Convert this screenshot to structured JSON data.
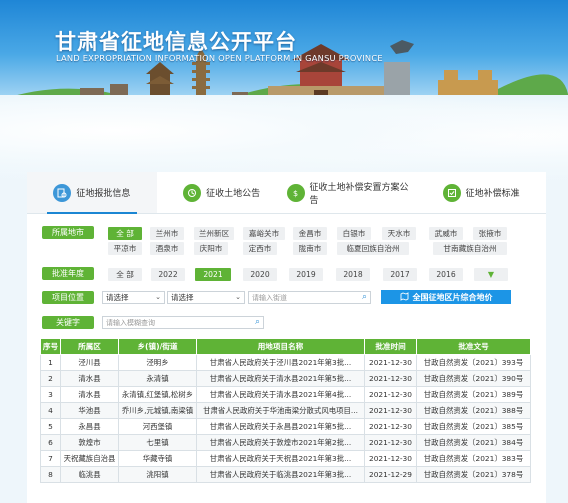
{
  "banner": {
    "title": "甘肃省征地信息公开平台",
    "subtitle": "LAND EXPROPRIATION INFORMATION OPEN PLATFORM IN GANSU PROVINCE"
  },
  "tabs": [
    {
      "label": "征地报批信息",
      "icon": "document-search-icon",
      "active": true
    },
    {
      "label": "征收土地公告",
      "icon": "announcement-icon",
      "active": false
    },
    {
      "label": "征收土地补偿安置方案公告",
      "icon": "compensation-icon",
      "active": false
    },
    {
      "label": "征地补偿标准",
      "icon": "standard-icon",
      "active": false
    }
  ],
  "filters": {
    "region_label": "所属地市",
    "regions": [
      "全 部",
      "兰州市",
      "兰州新区",
      "嘉峪关市",
      "金昌市",
      "白银市",
      "天水市",
      "武威市",
      "张掖市",
      "平凉市",
      "酒泉市",
      "庆阳市",
      "定西市",
      "陇南市",
      "临夏回族自治州",
      "甘南藏族自治州"
    ],
    "active_region": "全 部",
    "year_label": "批准年度",
    "years": [
      "全 部",
      "2022",
      "2021",
      "2020",
      "2019",
      "2018",
      "2017",
      "2016"
    ],
    "active_year": "2021",
    "location_label": "项目位置",
    "select1": "请选择",
    "select2": "请选择",
    "street_placeholder": "请输入街道",
    "map_button": "全国征地区片综合地价",
    "keyword_label": "关键字",
    "keyword_placeholder": "请输入模糊查询"
  },
  "table": {
    "headers": [
      "序号",
      "所属区",
      "乡(镇)/街道",
      "用地项目名称",
      "批准时间",
      "批准文号"
    ],
    "rows": [
      [
        "1",
        "泾川县",
        "泾明乡",
        "甘肃省人民政府关于泾川县2021年第3批...",
        "2021-12-30",
        "甘政自然资发〔2021〕393号"
      ],
      [
        "2",
        "清水县",
        "永清镇",
        "甘肃省人民政府关于清水县2021年第5批...",
        "2021-12-30",
        "甘政自然资发〔2021〕390号"
      ],
      [
        "3",
        "清水县",
        "永清镇,红堡镇,松树乡",
        "甘肃省人民政府关于清水县2021年第4批...",
        "2021-12-30",
        "甘政自然资发〔2021〕389号"
      ],
      [
        "4",
        "华池县",
        "乔川乡,元城镇,南梁镇",
        "甘肃省人民政府关于华池南梁分散式风电项目...",
        "2021-12-30",
        "甘政自然资发〔2021〕388号"
      ],
      [
        "5",
        "永昌县",
        "河西堡镇",
        "甘肃省人民政府关于永昌县2021年第5批...",
        "2021-12-30",
        "甘政自然资发〔2021〕385号"
      ],
      [
        "6",
        "敦煌市",
        "七里镇",
        "甘肃省人民政府关于敦煌市2021年第2批...",
        "2021-12-30",
        "甘政自然资发〔2021〕384号"
      ],
      [
        "7",
        "天祝藏族自治县",
        "华藏寺镇",
        "甘肃省人民政府关于天祝县2021年第3批...",
        "2021-12-30",
        "甘政自然资发〔2021〕383号"
      ],
      [
        "8",
        "临洮县",
        "洮阳镇",
        "甘肃省人民政府关于临洮县2021年第3批...",
        "2021-12-29",
        "甘政自然资发〔2021〕378号"
      ]
    ]
  },
  "colors": {
    "accent_green": "#5fb336",
    "accent_blue": "#1c95e6"
  }
}
